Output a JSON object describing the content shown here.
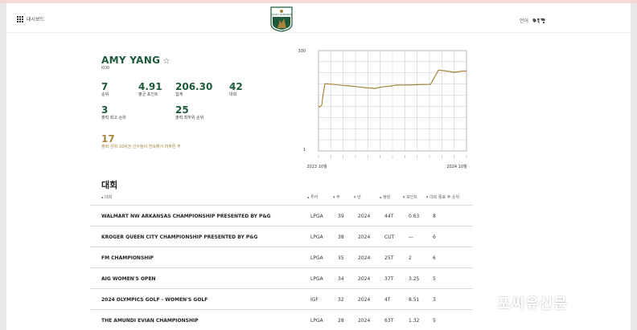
{
  "header": {
    "dashboard_label": "대시보드",
    "logo_text": "ROLEX RANKINGS",
    "lang_label": "언어"
  },
  "player": {
    "name": "AMY YANG",
    "country": "KOR"
  },
  "stats": [
    {
      "value": "7",
      "label": "순위"
    },
    {
      "value": "4.91",
      "label": "평균 포인트"
    },
    {
      "value": "206.30",
      "label": "합계"
    },
    {
      "value": "42",
      "label": "대회"
    },
    {
      "value": "3",
      "label": "출력 최고 순위"
    },
    {
      "value": "25",
      "label": "출력 최하위 순위"
    },
    {
      "value": "17",
      "label": "출력 상위 10위권 선수들이 연속해서 머무른 주"
    }
  ],
  "chart_data": {
    "type": "line",
    "x_start_label": "2023 10월",
    "x_end_label": "2024 10월",
    "ylim": [
      330,
      1
    ],
    "y_top_label": "330",
    "y_bottom_label": "1",
    "grid": true,
    "invert_y": true,
    "series_color": "#a6843a",
    "x": [
      0,
      2,
      4,
      6,
      8,
      10,
      20,
      30,
      40,
      50,
      60,
      70,
      80,
      90,
      95,
      97,
      100,
      110,
      120,
      130,
      140,
      150,
      160,
      170,
      180,
      185
    ],
    "values": [
      185,
      185,
      180,
      140,
      110,
      110,
      112,
      115,
      117,
      120,
      123,
      125,
      120,
      117,
      115,
      114,
      114,
      114,
      113,
      112,
      112,
      65,
      68,
      72,
      68,
      68
    ]
  },
  "tournaments_section": {
    "title": "대회",
    "columns": [
      "대회",
      "투어",
      "주",
      "년",
      "랭킹",
      "포인트",
      "대회 종료 후 순위"
    ],
    "rows": [
      {
        "name": "WALMART NW ARKANSAS CHAMPIONSHIP PRESENTED BY P&G",
        "tour": "LPGA",
        "week": "39",
        "year": "2024",
        "rank": "44T",
        "points": "0.63",
        "after": "8"
      },
      {
        "name": "KROGER QUEEN CITY CHAMPIONSHIP PRESENTED BY P&G",
        "tour": "LPGA",
        "week": "38",
        "year": "2024",
        "rank": "CUT",
        "points": "—",
        "after": "6"
      },
      {
        "name": "FM CHAMPIONSHIP",
        "tour": "LPGA",
        "week": "35",
        "year": "2024",
        "rank": "25T",
        "points": "2",
        "after": "6"
      },
      {
        "name": "AIG WOMEN'S OPEN",
        "tour": "LPGA",
        "week": "34",
        "year": "2024",
        "rank": "37T",
        "points": "3.25",
        "after": "5"
      },
      {
        "name": "2024 OLYMPICS GOLF - WOMEN'S GOLF",
        "tour": "IGF",
        "week": "32",
        "year": "2024",
        "rank": "4T",
        "points": "8.51",
        "after": "3"
      },
      {
        "name": "THE AMUNDI EVIAN CHAMPIONSHIP",
        "tour": "LPGA",
        "week": "28",
        "year": "2024",
        "rank": "63T",
        "points": "1.32",
        "after": "5"
      }
    ]
  },
  "watermark": "포씨유신문"
}
